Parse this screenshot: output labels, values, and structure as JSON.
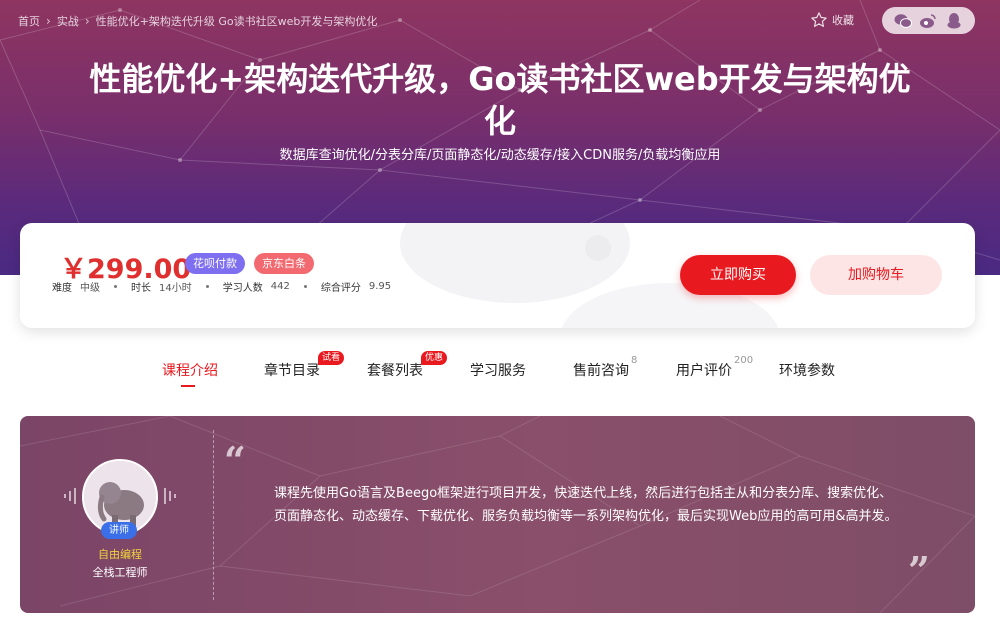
{
  "breadcrumb": {
    "items": [
      "首页",
      "实战",
      "性能优化+架构迭代升级 Go读书社区web开发与架构优化"
    ],
    "separator": "›"
  },
  "header": {
    "favorite_label": "收藏",
    "share_icons": [
      "wechat-icon",
      "weibo-icon",
      "qq-icon"
    ],
    "title": "性能优化+架构迭代升级，Go读书社区web开发与架构优化",
    "subtitle": "数据库查询优化/分表分库/页面静态化/动态缓存/接入CDN服务/负载均衡应用"
  },
  "purchase": {
    "price": "￥299.00",
    "tags": [
      "花呗付款",
      "京东白条"
    ],
    "stats": [
      {
        "label": "难度",
        "value": "中级"
      },
      {
        "label": "时长",
        "value": "14小时"
      },
      {
        "label": "学习人数",
        "value": "442"
      },
      {
        "label": "综合评分",
        "value": "9.95"
      }
    ],
    "buy_label": "立即购买",
    "cart_label": "加购物车"
  },
  "tabs": [
    {
      "label": "课程介绍",
      "active": true
    },
    {
      "label": "章节目录",
      "badge": "试看"
    },
    {
      "label": "套餐列表",
      "badge": "优惠"
    },
    {
      "label": "学习服务"
    },
    {
      "label": "售前咨询",
      "count": "8"
    },
    {
      "label": "用户评价",
      "count": "200"
    },
    {
      "label": "环境参数"
    }
  ],
  "teacher": {
    "badge": "讲师",
    "name": "自由编程",
    "role": "全栈工程师"
  },
  "intro": {
    "open_quote": "“",
    "close_quote": "”",
    "text": "课程先使用Go语言及Beego框架进行项目开发，快速迭代上线，然后进行包括主从和分表分库、搜索优化、页面静态化、动态缓存、下载优化、服务负载均衡等一系列架构优化，最后实现Web应用的高可用&高并发。"
  },
  "colors": {
    "accent": "#e8191f",
    "price": "#e02f2f",
    "huabei": "#7e6ef0",
    "jd": "#f26a6f",
    "teacher_name": "#f2d13c",
    "teacher_badge": "#3a6fe8"
  }
}
